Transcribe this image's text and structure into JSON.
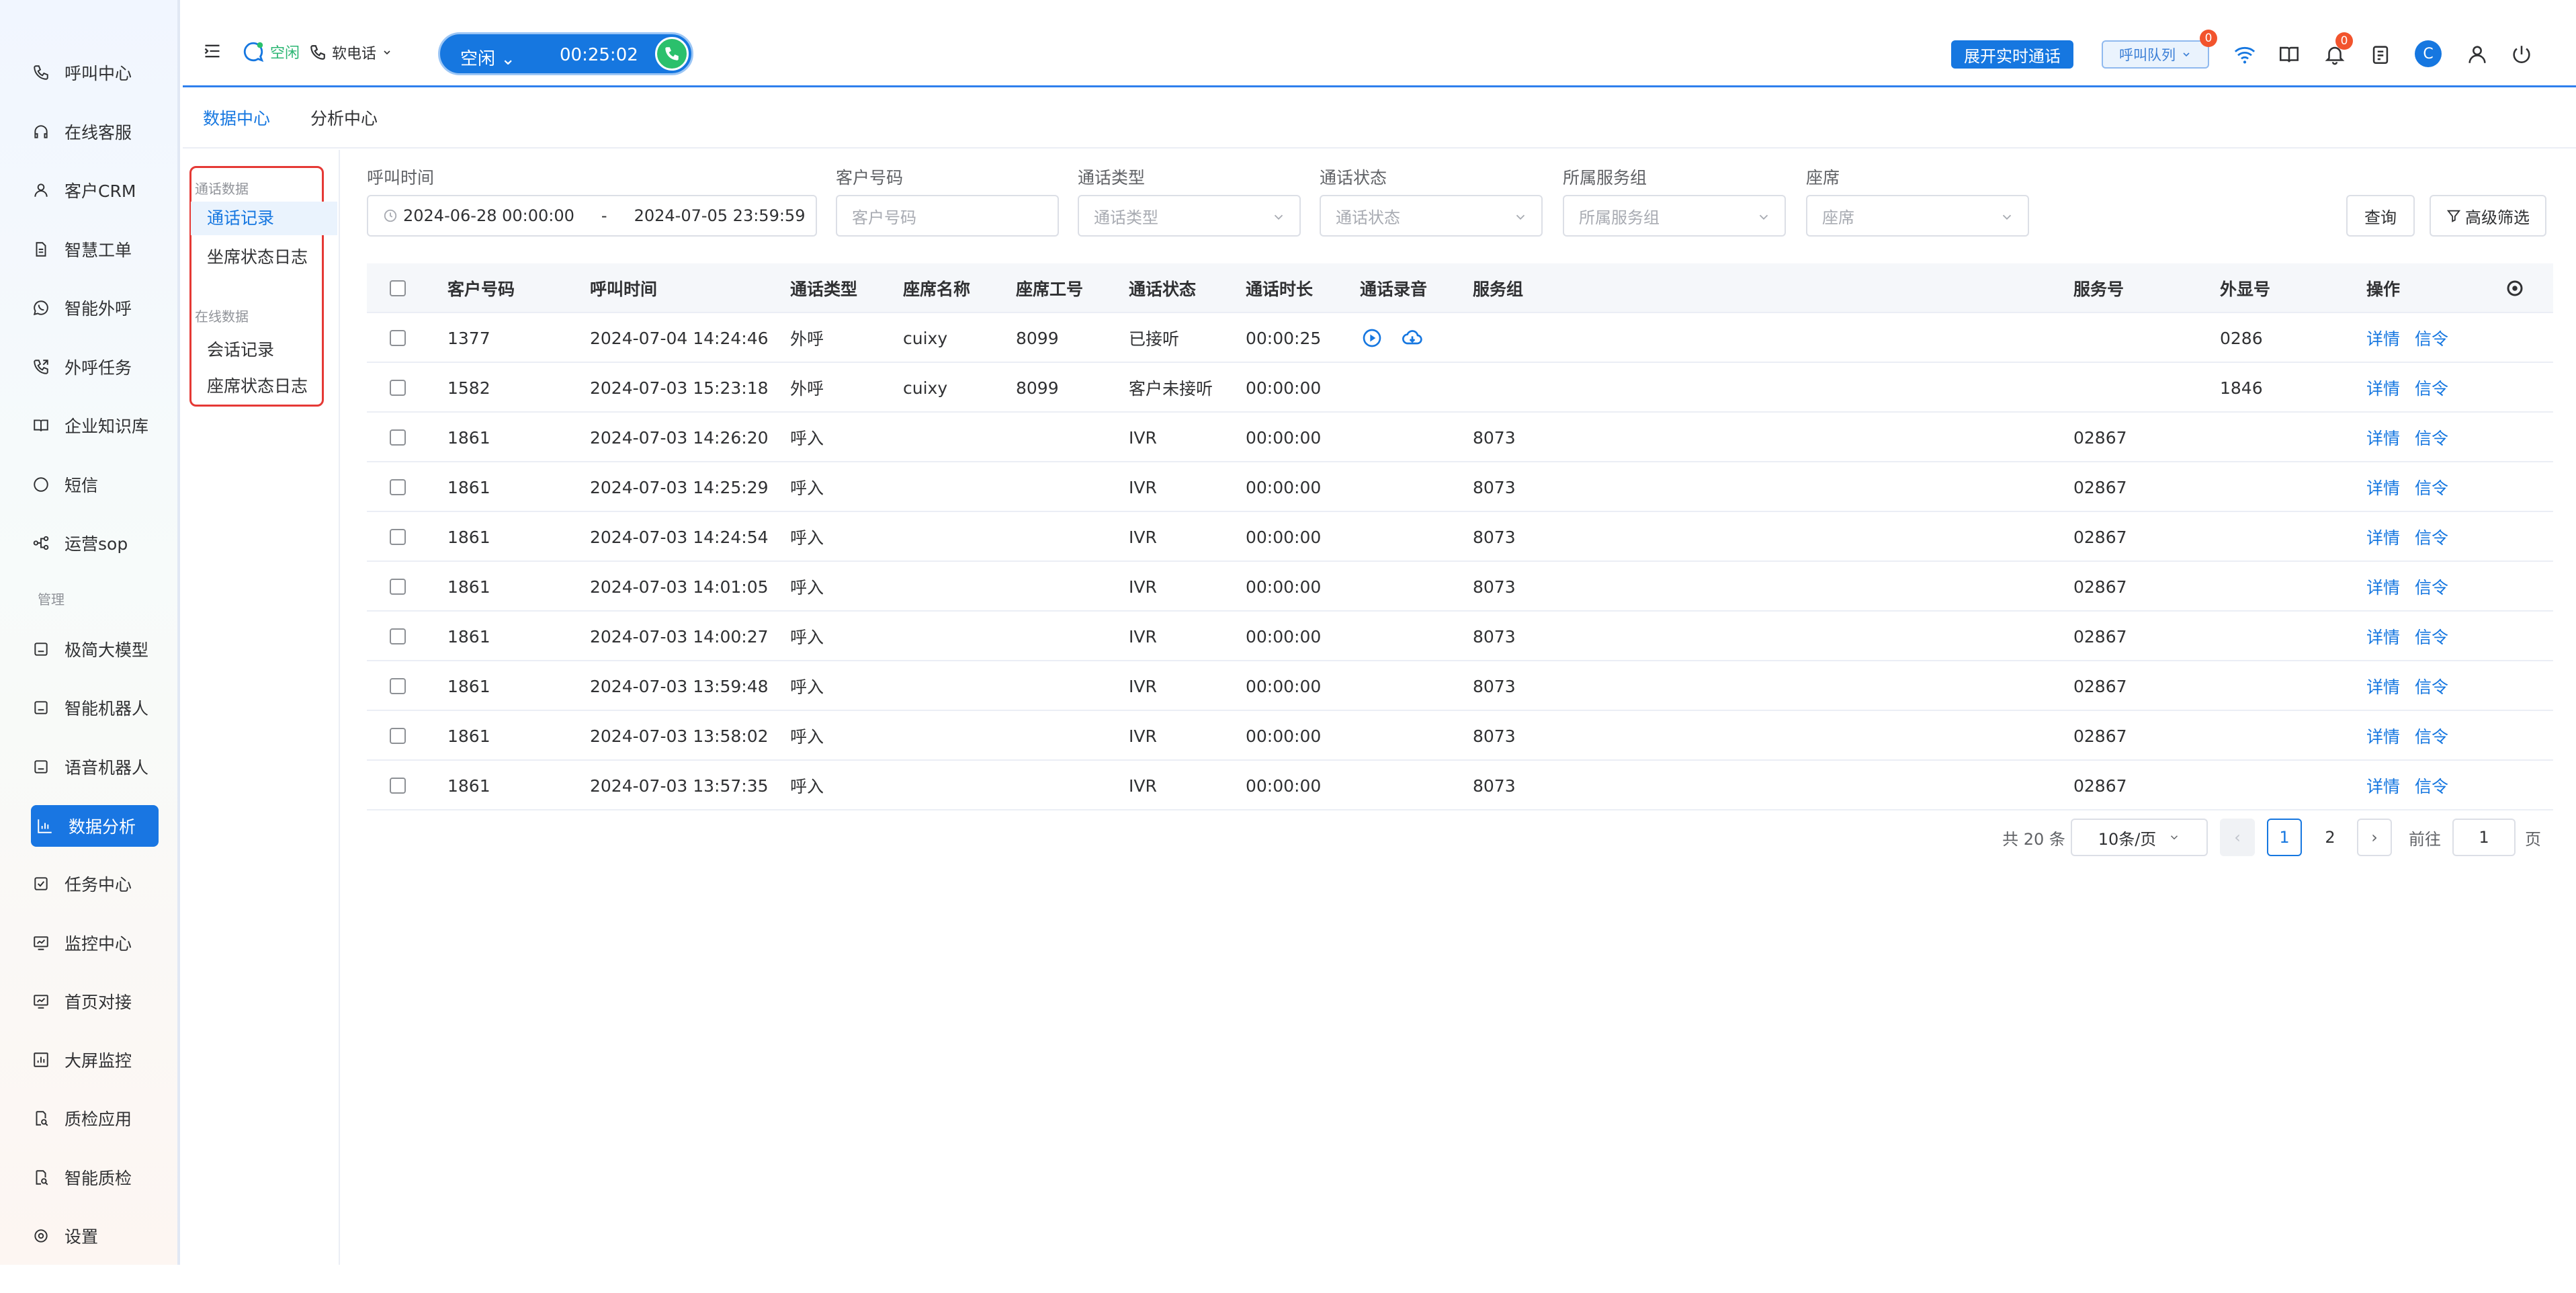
{
  "sidebar": {
    "items": [
      {
        "label": "呼叫中心",
        "icon": "phone-icon"
      },
      {
        "label": "在线客服",
        "icon": "headset-icon"
      },
      {
        "label": "客户CRM",
        "icon": "user-icon"
      },
      {
        "label": "智慧工单",
        "icon": "document-icon"
      },
      {
        "label": "智能外呼",
        "icon": "whatsapp-phone-icon"
      },
      {
        "label": "外呼任务",
        "icon": "outbound-call-icon"
      },
      {
        "label": "企业知识库",
        "icon": "book-icon"
      },
      {
        "label": "短信",
        "icon": "message-icon"
      },
      {
        "label": "运营sop",
        "icon": "flow-icon"
      }
    ],
    "section_label": "管理",
    "manage_items": [
      {
        "label": "极简大模型",
        "icon": "robot-icon"
      },
      {
        "label": "智能机器人",
        "icon": "robot-icon"
      },
      {
        "label": "语音机器人",
        "icon": "robot-icon"
      },
      {
        "label": "数据分析",
        "icon": "chart-icon",
        "active": true
      },
      {
        "label": "任务中心",
        "icon": "task-icon"
      },
      {
        "label": "监控中心",
        "icon": "monitor-icon"
      },
      {
        "label": "首页对接",
        "icon": "monitor-icon"
      },
      {
        "label": "大屏监控",
        "icon": "screen-chart-icon"
      },
      {
        "label": "质检应用",
        "icon": "inspection-icon"
      },
      {
        "label": "智能质检",
        "icon": "inspection-icon"
      },
      {
        "label": "设置",
        "icon": "gear-icon"
      }
    ]
  },
  "topbar": {
    "status_label": "空闲",
    "softphone_label": "软电话",
    "call_state": "空闲",
    "call_timer": "00:25:02",
    "realtime_button": "展开实时通话",
    "queue_label": "呼叫队列",
    "queue_badge": "0",
    "notify_badge": "0",
    "avatar_letter": "C"
  },
  "tabs": {
    "data_center": "数据中心",
    "analysis_center": "分析中心"
  },
  "data_nav": {
    "group1": "通话数据",
    "group1_items": [
      "通话记录",
      "坐席状态日志"
    ],
    "group2": "在线数据",
    "group2_items": [
      "会话记录",
      "座席状态日志"
    ]
  },
  "filters": {
    "call_time_label": "呼叫时间",
    "date_start": "2024-06-28 00:00:00",
    "date_sep": "-",
    "date_end": "2024-07-05 23:59:59",
    "customer_label": "客户号码",
    "customer_placeholder": "客户号码",
    "type_label": "通话类型",
    "type_placeholder": "通话类型",
    "status_label": "通话状态",
    "status_placeholder": "通话状态",
    "group_label": "所属服务组",
    "group_placeholder": "所属服务组",
    "seat_label": "座席",
    "seat_placeholder": "座席",
    "query_button": "查询",
    "advanced_button": "高级筛选"
  },
  "table": {
    "headers": {
      "customer": "客户号码",
      "time": "呼叫时间",
      "type": "通话类型",
      "agent_name": "座席名称",
      "agent_id": "座席工号",
      "status": "通话状态",
      "duration": "通话时长",
      "recording": "通话录音",
      "group": "服务组",
      "service_no": "服务号",
      "caller_id": "外显号",
      "actions": "操作"
    },
    "action_detail": "详情",
    "action_signal": "信令",
    "rows": [
      {
        "customer": "1377",
        "time": "2024-07-04 14:24:46",
        "type": "外呼",
        "agent_name": "cuixy",
        "agent_id": "8099",
        "status": "已接听",
        "duration": "00:00:25",
        "group": "",
        "service_no": "",
        "caller_id": "0286",
        "has_recording": true
      },
      {
        "customer": "1582",
        "time": "2024-07-03 15:23:18",
        "type": "外呼",
        "agent_name": "cuixy",
        "agent_id": "8099",
        "status": "客户未接听",
        "duration": "00:00:00",
        "group": "",
        "service_no": "",
        "caller_id": "1846"
      },
      {
        "customer": "1861",
        "time": "2024-07-03 14:26:20",
        "type": "呼入",
        "agent_name": "",
        "agent_id": "",
        "status": "IVR",
        "duration": "00:00:00",
        "group": "8073",
        "service_no": "02867",
        "caller_id": ""
      },
      {
        "customer": "1861",
        "time": "2024-07-03 14:25:29",
        "type": "呼入",
        "agent_name": "",
        "agent_id": "",
        "status": "IVR",
        "duration": "00:00:00",
        "group": "8073",
        "service_no": "02867",
        "caller_id": ""
      },
      {
        "customer": "1861",
        "time": "2024-07-03 14:24:54",
        "type": "呼入",
        "agent_name": "",
        "agent_id": "",
        "status": "IVR",
        "duration": "00:00:00",
        "group": "8073",
        "service_no": "02867",
        "caller_id": ""
      },
      {
        "customer": "1861",
        "time": "2024-07-03 14:01:05",
        "type": "呼入",
        "agent_name": "",
        "agent_id": "",
        "status": "IVR",
        "duration": "00:00:00",
        "group": "8073",
        "service_no": "02867",
        "caller_id": ""
      },
      {
        "customer": "1861",
        "time": "2024-07-03 14:00:27",
        "type": "呼入",
        "agent_name": "",
        "agent_id": "",
        "status": "IVR",
        "duration": "00:00:00",
        "group": "8073",
        "service_no": "02867",
        "caller_id": ""
      },
      {
        "customer": "1861",
        "time": "2024-07-03 13:59:48",
        "type": "呼入",
        "agent_name": "",
        "agent_id": "",
        "status": "IVR",
        "duration": "00:00:00",
        "group": "8073",
        "service_no": "02867",
        "caller_id": ""
      },
      {
        "customer": "1861",
        "time": "2024-07-03 13:58:02",
        "type": "呼入",
        "agent_name": "",
        "agent_id": "",
        "status": "IVR",
        "duration": "00:00:00",
        "group": "8073",
        "service_no": "02867",
        "caller_id": ""
      },
      {
        "customer": "1861",
        "time": "2024-07-03 13:57:35",
        "type": "呼入",
        "agent_name": "",
        "agent_id": "",
        "status": "IVR",
        "duration": "00:00:00",
        "group": "8073",
        "service_no": "02867",
        "caller_id": ""
      }
    ]
  },
  "pagination": {
    "total": "共 20 条",
    "page_size": "10条/页",
    "pages": [
      "1",
      "2"
    ],
    "current_page": "1",
    "goto_label": "前往",
    "goto_value": "1",
    "page_suffix": "页"
  },
  "colors": {
    "primary": "#1677e0",
    "highlight_box": "#e53935",
    "call_green": "#2bc06c",
    "badge_red": "#f2542d"
  }
}
